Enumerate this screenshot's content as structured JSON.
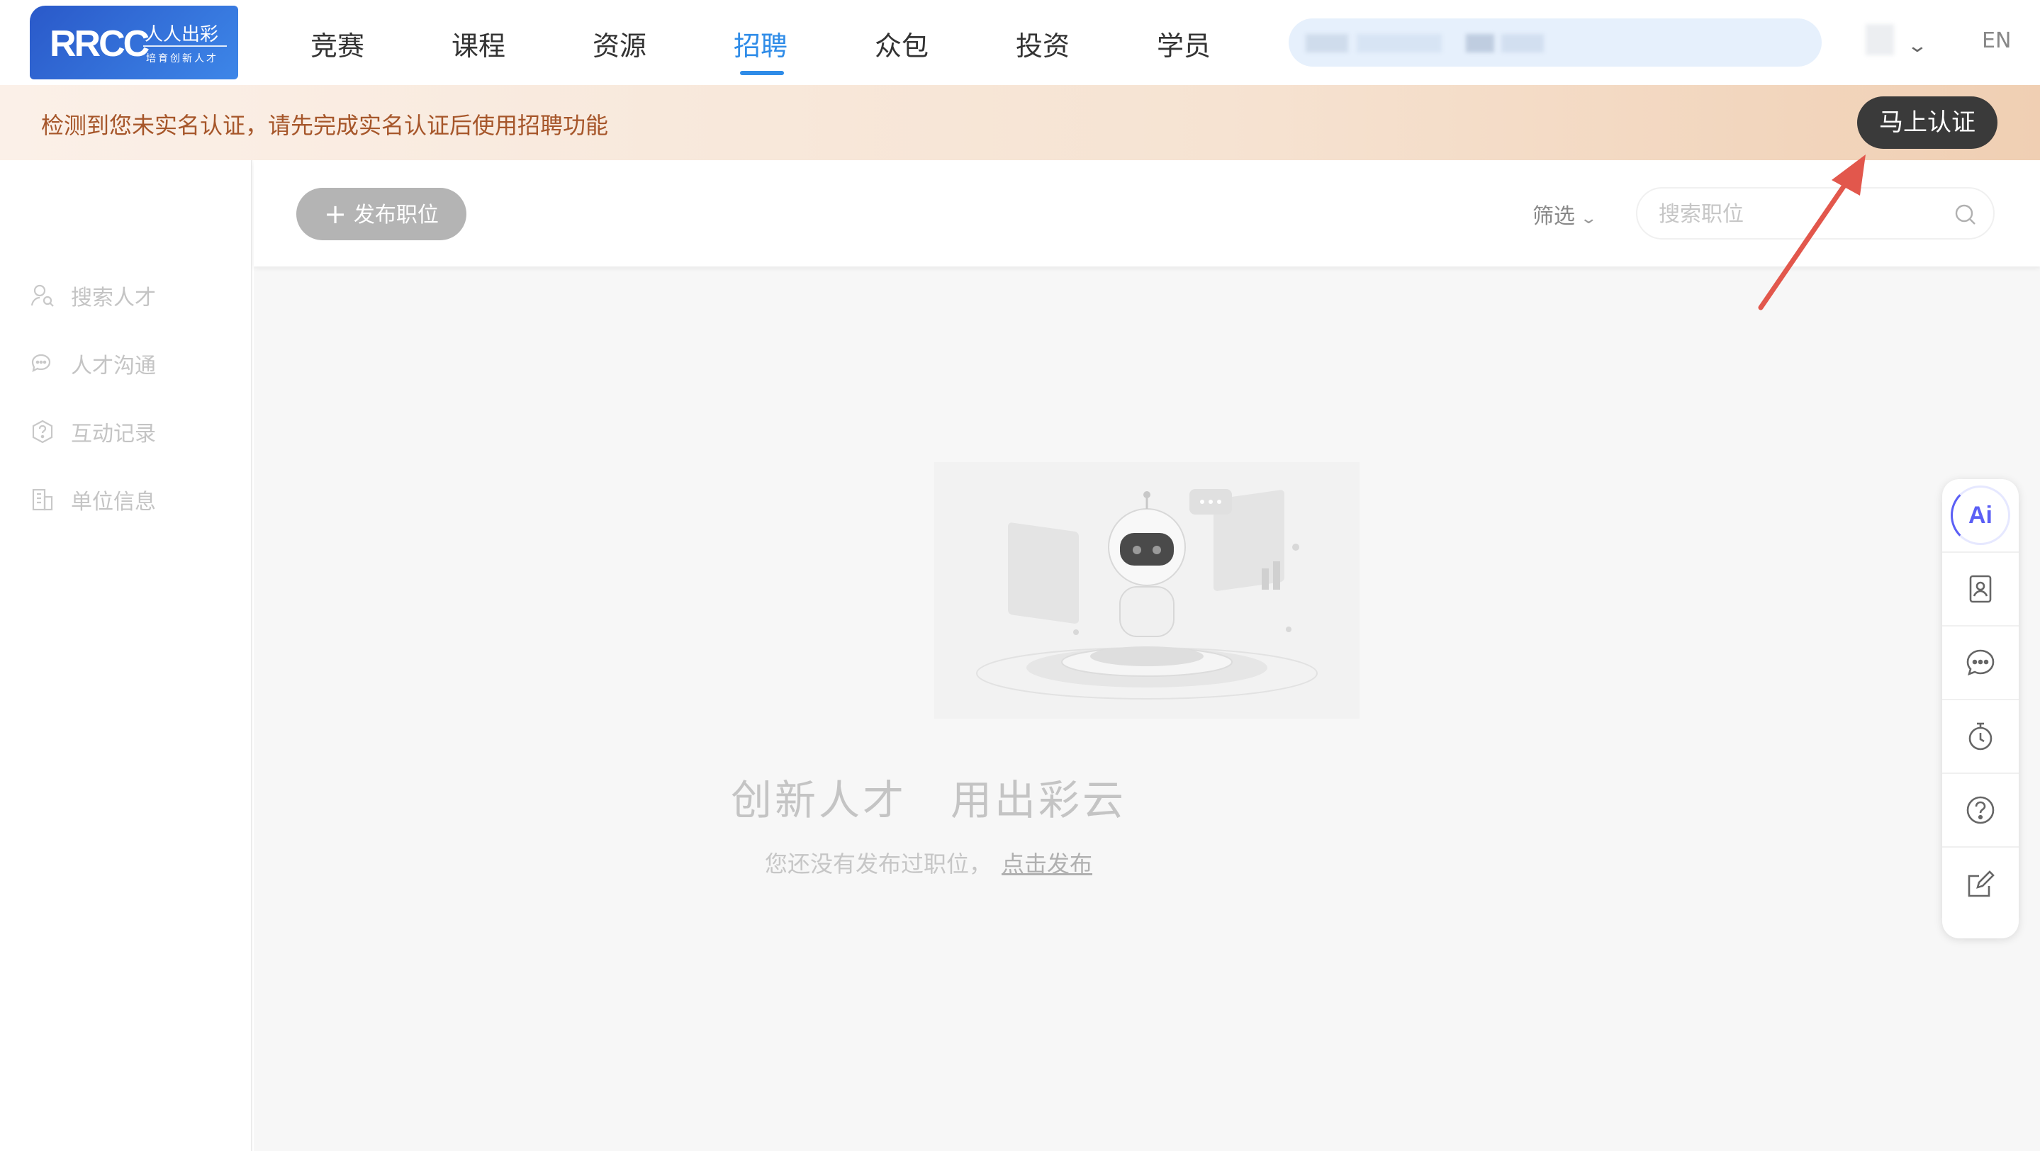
{
  "logo": {
    "brand": "RRCC",
    "cn_name": "人人出彩",
    "subtitle": "培育创新人才"
  },
  "nav": {
    "items": [
      {
        "label": "竞赛",
        "active": false
      },
      {
        "label": "课程",
        "active": false
      },
      {
        "label": "资源",
        "active": false
      },
      {
        "label": "招聘",
        "active": true
      },
      {
        "label": "众包",
        "active": false
      },
      {
        "label": "投资",
        "active": false
      },
      {
        "label": "学员",
        "active": false
      }
    ],
    "lang_label": "EN",
    "accent_color": "#2f8ce8"
  },
  "banner": {
    "message": "检测到您未实名认证，请先完成实名认证后使用招聘功能",
    "button_label": "马上认证"
  },
  "sidebar": {
    "items": [
      {
        "label": "搜索人才",
        "icon": "user-search-icon"
      },
      {
        "label": "人才沟通",
        "icon": "chat-bubbles-icon"
      },
      {
        "label": "互动记录",
        "icon": "question-shield-icon"
      },
      {
        "label": "单位信息",
        "icon": "building-icon"
      }
    ]
  },
  "toolbar": {
    "publish_label": "发布职位",
    "filter_label": "筛选",
    "search_placeholder": "搜索职位"
  },
  "empty_state": {
    "slogan": "创新人才　用出彩云",
    "message": "您还没有发布过职位，",
    "link_label": "点击发布"
  },
  "float_bar": {
    "items": [
      {
        "name": "ai-assistant",
        "label": "Ai"
      },
      {
        "name": "contact-card-icon"
      },
      {
        "name": "chat-icon"
      },
      {
        "name": "timer-icon"
      },
      {
        "name": "help-icon"
      },
      {
        "name": "edit-icon"
      }
    ]
  }
}
